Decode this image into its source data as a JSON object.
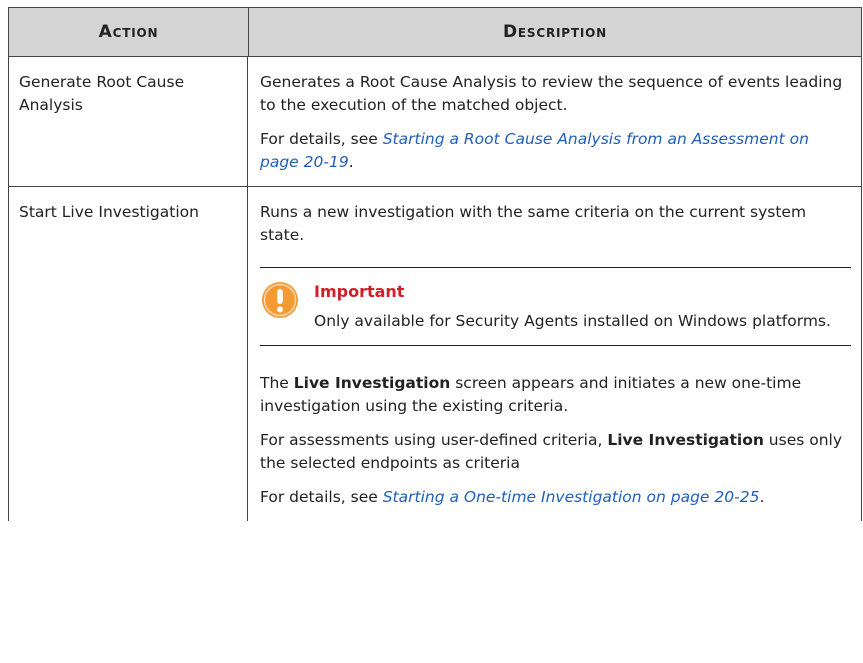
{
  "header": {
    "action": "Action",
    "description": "Description"
  },
  "rows": [
    {
      "action": "Generate Root Cause Analysis",
      "desc": "Generates a Root Cause Analysis to review the sequence of events leading to the execution of the matched object.",
      "details_prefix": "For details, see ",
      "details_link": "Starting a Root Cause Analysis from an Assessment on page 20-19",
      "details_suffix": "."
    },
    {
      "action": "Start Live Investigation",
      "desc": "Runs a new investigation with the same criteria on the current system state.",
      "note_title": "Important",
      "note_text": "Only available for Security Agents installed on Windows platforms.",
      "p1_a": "The ",
      "p1_bold": "Live Investigation",
      "p1_b": " screen appears and initiates a new one-time investigation using the existing criteria.",
      "p2_a": "For assessments using user-defined criteria, ",
      "p2_bold": "Live Investigation",
      "p2_b": " uses only the selected endpoints as criteria",
      "details_prefix": "For details, see ",
      "details_link": "Starting a One-time Investigation on page 20-25",
      "details_suffix": "."
    }
  ],
  "colors": {
    "link": "#1f5fb8",
    "important": "#d01f28",
    "icon": "#f39a33",
    "header_bg": "#d4d4d4"
  },
  "icons": {
    "note": "warning-exclamation-icon"
  }
}
